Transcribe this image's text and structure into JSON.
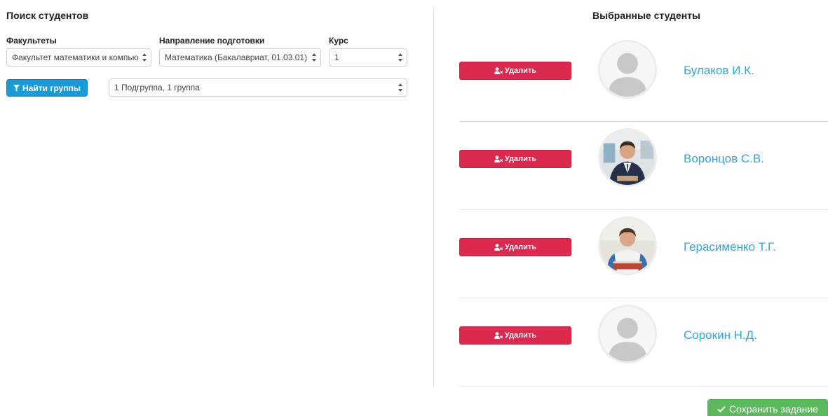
{
  "search": {
    "title": "Поиск студентов",
    "faculties": {
      "label": "Факультеты",
      "value": "Факультет математики и компьютерных наук"
    },
    "direction": {
      "label": "Направление подготовки",
      "value": "Математика (Бакалавриат, 01.03.01)"
    },
    "course": {
      "label": "Курс",
      "value": "1"
    },
    "find_button_label": "Найти группы",
    "find_button_icon": "filter-icon",
    "group": {
      "value": "1 Подгруппа, 1 группа"
    }
  },
  "selected": {
    "title": "Выбранные студенты",
    "remove_label": "Удалить",
    "remove_icon": "user-remove-icon",
    "students": [
      {
        "name": "Булаков И.К.",
        "avatar": "default-avatar"
      },
      {
        "name": "Воронцов С.В.",
        "avatar": "photo-avatar"
      },
      {
        "name": "Герасименко Т.Г.",
        "avatar": "photo-avatar"
      },
      {
        "name": "Сорокин Н.Д.",
        "avatar": "default-avatar"
      }
    ]
  },
  "save_button_label": "Сохранить задание",
  "save_button_icon": "checkmark-icon",
  "colors": {
    "primary": "#1a9ad6",
    "danger": "#dc2950",
    "success": "#5cb85c",
    "link": "#2da6e0"
  }
}
